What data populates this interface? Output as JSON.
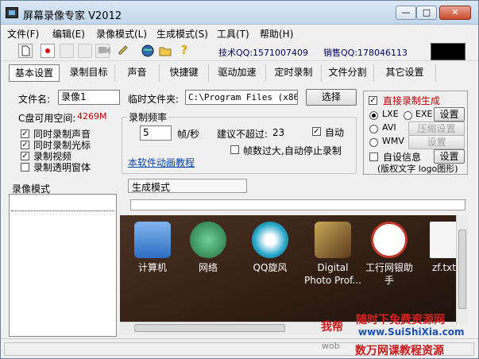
{
  "window": {
    "title": "屏幕录像专家 V2012",
    "min": "—",
    "max": "□",
    "close": "✕"
  },
  "menu": [
    "文件(F)",
    "编辑(E)",
    "录像模式(L)",
    "生成模式(S)",
    "工具(T)",
    "帮助(H)"
  ],
  "toolbar": {
    "tech_qq": "技术QQ:1571007409",
    "sales_qq": "销售QQ:178046113"
  },
  "tabs": [
    "基本设置",
    "录制目标",
    "声音",
    "快捷键",
    "驱动加速",
    "定时录制",
    "文件分割",
    "其它设置"
  ],
  "basic": {
    "filename_label": "文件名:",
    "filename_value": "录像1",
    "tempdir_label": "临时文件夹:",
    "tempdir_value": "C:\\Program Files (x86)\\",
    "browse_button": "选择",
    "disk_label": "C盘可用空间:",
    "disk_value": "4269M",
    "checks": [
      {
        "label": "同时录制声音",
        "checked": true
      },
      {
        "label": "同时录制光标",
        "checked": true
      },
      {
        "label": "录制视频",
        "checked": true
      },
      {
        "label": "录制透明窗体",
        "checked": false
      }
    ],
    "freq_group": "录制频率",
    "freq_value": "5",
    "freq_unit": "帧/秒",
    "suggest_label": "建议不超过:",
    "suggest_value": "23",
    "auto_label": "自动",
    "auto_checked": true,
    "autostop_label": "帧数过大,自动停止录制",
    "autostop_checked": false,
    "tutorial_link": "本软件动画教程"
  },
  "right_box": {
    "direct_label": "直接录制生成",
    "direct_checked": true,
    "lxe": "LXE",
    "exe": "EXE",
    "avi": "AVI",
    "wmv": "WMV",
    "setup_button": "设置",
    "compress_button": "压缩设置",
    "setup2_button": "设置",
    "selfinfo_label": "自设信息",
    "selfinfo_button": "设置",
    "copyright_note": "(版权文字 logo图形)"
  },
  "modes": {
    "record_mode": "录像模式",
    "generate_mode": "生成模式"
  },
  "desktop_icons": [
    {
      "label": "计算机",
      "color": "#3a7bd5"
    },
    {
      "label": "网络",
      "color": "#2b8a3e"
    },
    {
      "label": "QQ旋风",
      "color": "#27a6c8"
    },
    {
      "label": "Digital Photo Prof...",
      "color": "#8a6a2a"
    },
    {
      "label": "工行网银助手",
      "color": "#c0392b"
    },
    {
      "label": "zf.txt",
      "color": "#e8e8e8"
    }
  ],
  "watermark": {
    "line1": "我帮",
    "line2": "随时下免费资源网",
    "line3": "www.SuiShiXia.com",
    "line4": "数万网课教程资源",
    "line5": "wob"
  },
  "colors": {
    "accent_red": "#c00000",
    "link_blue": "#0645ad"
  }
}
